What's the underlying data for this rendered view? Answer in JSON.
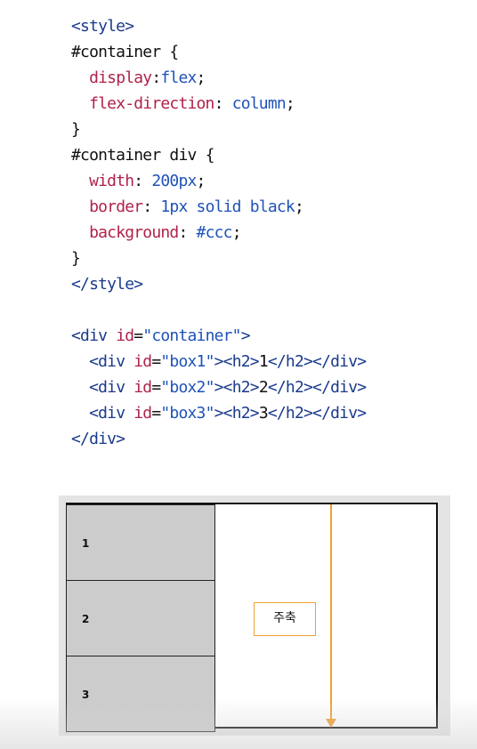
{
  "code": {
    "lines": [
      [
        {
          "t": "<style>",
          "k": "tag"
        }
      ],
      [
        {
          "t": "#container ",
          "k": "sel"
        },
        {
          "t": "{",
          "k": "punc"
        }
      ],
      [
        {
          "t": "  ",
          "k": "punc"
        },
        {
          "t": "display",
          "k": "prop"
        },
        {
          "t": ":",
          "k": "punc"
        },
        {
          "t": "flex",
          "k": "val"
        },
        {
          "t": ";",
          "k": "punc"
        }
      ],
      [
        {
          "t": "  ",
          "k": "punc"
        },
        {
          "t": "flex-direction",
          "k": "prop"
        },
        {
          "t": ": ",
          "k": "punc"
        },
        {
          "t": "column",
          "k": "val"
        },
        {
          "t": ";",
          "k": "punc"
        }
      ],
      [
        {
          "t": "}",
          "k": "punc"
        }
      ],
      [
        {
          "t": "#container div ",
          "k": "sel"
        },
        {
          "t": "{",
          "k": "punc"
        }
      ],
      [
        {
          "t": "  ",
          "k": "punc"
        },
        {
          "t": "width",
          "k": "prop"
        },
        {
          "t": ": ",
          "k": "punc"
        },
        {
          "t": "200px",
          "k": "val"
        },
        {
          "t": ";",
          "k": "punc"
        }
      ],
      [
        {
          "t": "  ",
          "k": "punc"
        },
        {
          "t": "border",
          "k": "prop"
        },
        {
          "t": ": ",
          "k": "punc"
        },
        {
          "t": "1px solid black",
          "k": "val"
        },
        {
          "t": ";",
          "k": "punc"
        }
      ],
      [
        {
          "t": "  ",
          "k": "punc"
        },
        {
          "t": "background",
          "k": "prop"
        },
        {
          "t": ": ",
          "k": "punc"
        },
        {
          "t": "#ccc",
          "k": "val"
        },
        {
          "t": ";",
          "k": "punc"
        }
      ],
      [
        {
          "t": "}",
          "k": "punc"
        }
      ],
      [
        {
          "t": "</style>",
          "k": "tag"
        }
      ],
      [],
      [
        {
          "t": "<div ",
          "k": "tag"
        },
        {
          "t": "id",
          "k": "attr"
        },
        {
          "t": "=",
          "k": "punc"
        },
        {
          "t": "\"container\"",
          "k": "str"
        },
        {
          "t": ">",
          "k": "tag"
        }
      ],
      [
        {
          "t": "  ",
          "k": "punc"
        },
        {
          "t": "<div ",
          "k": "tag"
        },
        {
          "t": "id",
          "k": "attr"
        },
        {
          "t": "=",
          "k": "punc"
        },
        {
          "t": "\"box1\"",
          "k": "str"
        },
        {
          "t": "><h2>",
          "k": "tag"
        },
        {
          "t": "1",
          "k": "punc"
        },
        {
          "t": "</h2></div>",
          "k": "tag"
        }
      ],
      [
        {
          "t": "  ",
          "k": "punc"
        },
        {
          "t": "<div ",
          "k": "tag"
        },
        {
          "t": "id",
          "k": "attr"
        },
        {
          "t": "=",
          "k": "punc"
        },
        {
          "t": "\"box2\"",
          "k": "str"
        },
        {
          "t": "><h2>",
          "k": "tag"
        },
        {
          "t": "2",
          "k": "punc"
        },
        {
          "t": "</h2></div>",
          "k": "tag"
        }
      ],
      [
        {
          "t": "  ",
          "k": "punc"
        },
        {
          "t": "<div ",
          "k": "tag"
        },
        {
          "t": "id",
          "k": "attr"
        },
        {
          "t": "=",
          "k": "punc"
        },
        {
          "t": "\"box3\"",
          "k": "str"
        },
        {
          "t": "><h2>",
          "k": "tag"
        },
        {
          "t": "3",
          "k": "punc"
        },
        {
          "t": "</h2></div>",
          "k": "tag"
        }
      ],
      [
        {
          "t": "</div>",
          "k": "tag"
        }
      ]
    ]
  },
  "demo": {
    "boxes": [
      {
        "label": "1"
      },
      {
        "label": "2"
      },
      {
        "label": "3"
      }
    ],
    "axis_label": "주축",
    "axis_color": "#f0a030",
    "box_background": "#cccccc"
  }
}
